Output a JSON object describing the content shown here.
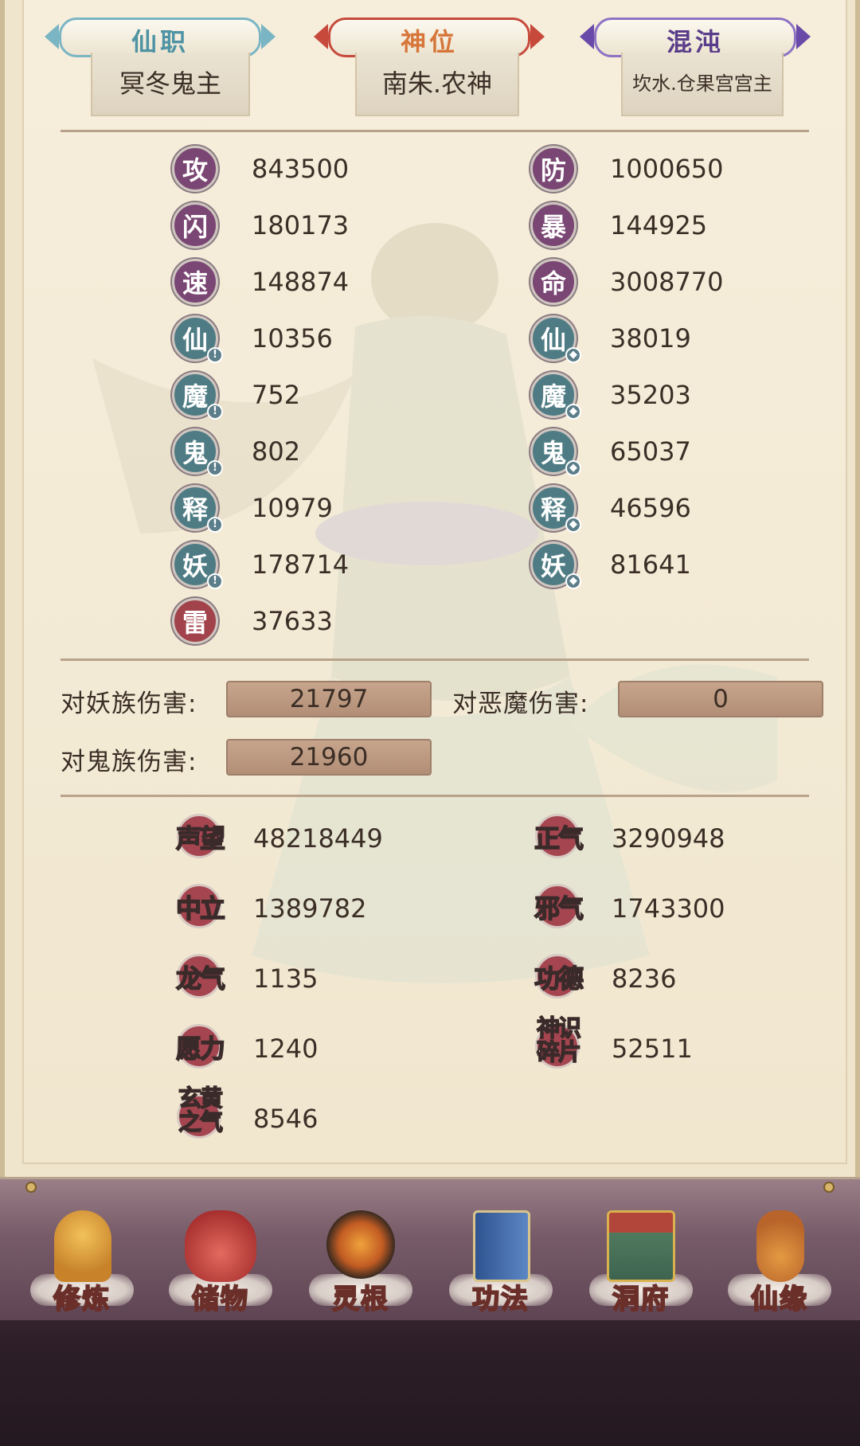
{
  "tabs": [
    {
      "title": "仙职",
      "value": "冥冬鬼主",
      "color": "#4f93a4",
      "arrow": "#7ab5c4"
    },
    {
      "title": "神位",
      "value": "南朱.农神",
      "color": "#d6763a",
      "arrow": "#c6493c"
    },
    {
      "title": "混沌",
      "value": "坎水.仓果宫宫主",
      "color": "#5a3d8a",
      "arrow": "#6a4aa8"
    }
  ],
  "stats": {
    "left": [
      {
        "icon": "攻",
        "value": "843500",
        "style": "purple"
      },
      {
        "icon": "闪",
        "value": "180173",
        "style": "purple"
      },
      {
        "icon": "速",
        "value": "148874",
        "style": "purple"
      },
      {
        "icon": "仙",
        "value": "10356",
        "style": "teal",
        "badge": "!"
      },
      {
        "icon": "魔",
        "value": "752",
        "style": "teal",
        "badge": "!"
      },
      {
        "icon": "鬼",
        "value": "802",
        "style": "teal",
        "badge": "!"
      },
      {
        "icon": "释",
        "value": "10979",
        "style": "teal",
        "badge": "!"
      },
      {
        "icon": "妖",
        "value": "178714",
        "style": "teal",
        "badge": "!"
      },
      {
        "icon": "雷",
        "value": "37633",
        "style": "red"
      }
    ],
    "right": [
      {
        "icon": "防",
        "value": "1000650",
        "style": "purple"
      },
      {
        "icon": "暴",
        "value": "144925",
        "style": "purple"
      },
      {
        "icon": "命",
        "value": "3008770",
        "style": "purple"
      },
      {
        "icon": "仙",
        "value": "38019",
        "style": "teal",
        "badge": "◆"
      },
      {
        "icon": "魔",
        "value": "35203",
        "style": "teal",
        "badge": "◆"
      },
      {
        "icon": "鬼",
        "value": "65037",
        "style": "teal",
        "badge": "◆"
      },
      {
        "icon": "释",
        "value": "46596",
        "style": "teal",
        "badge": "◆"
      },
      {
        "icon": "妖",
        "value": "81641",
        "style": "teal",
        "badge": "◆"
      }
    ]
  },
  "damage": {
    "yao_label": "对妖族伤害:",
    "yao_value": "21797",
    "demon_label": "对恶魔伤害:",
    "demon_value": "0",
    "ghost_label": "对鬼族伤害:",
    "ghost_value": "21960"
  },
  "resources": {
    "left": [
      {
        "name": "声望",
        "value": "48218449"
      },
      {
        "name": "中立",
        "value": "1389782"
      },
      {
        "name": "龙气",
        "value": "1135"
      },
      {
        "name": "愿力",
        "value": "1240"
      },
      {
        "name": "玄黄之气",
        "line1": "玄黄",
        "line2": "之气",
        "value": "8546"
      }
    ],
    "right": [
      {
        "name": "正气",
        "value": "3290948"
      },
      {
        "name": "邪气",
        "value": "1743300"
      },
      {
        "name": "功德",
        "value": "8236"
      },
      {
        "name": "神识碎片",
        "line1": "神识",
        "line2": "碎片",
        "value": "52511"
      }
    ]
  },
  "nav": [
    {
      "label": "修炼",
      "icon": "cultivation-icon",
      "color": "#d99a3a"
    },
    {
      "label": "储物",
      "icon": "storage-bag-icon",
      "color": "#c94a45"
    },
    {
      "label": "灵根",
      "icon": "spirit-root-icon",
      "color": "#b8622e"
    },
    {
      "label": "功法",
      "icon": "skill-book-icon",
      "color": "#3d6aa8"
    },
    {
      "label": "洞府",
      "icon": "cave-house-icon",
      "color": "#5f8a6a"
    },
    {
      "label": "仙缘",
      "icon": "gourd-icon",
      "color": "#c06a3a"
    }
  ]
}
